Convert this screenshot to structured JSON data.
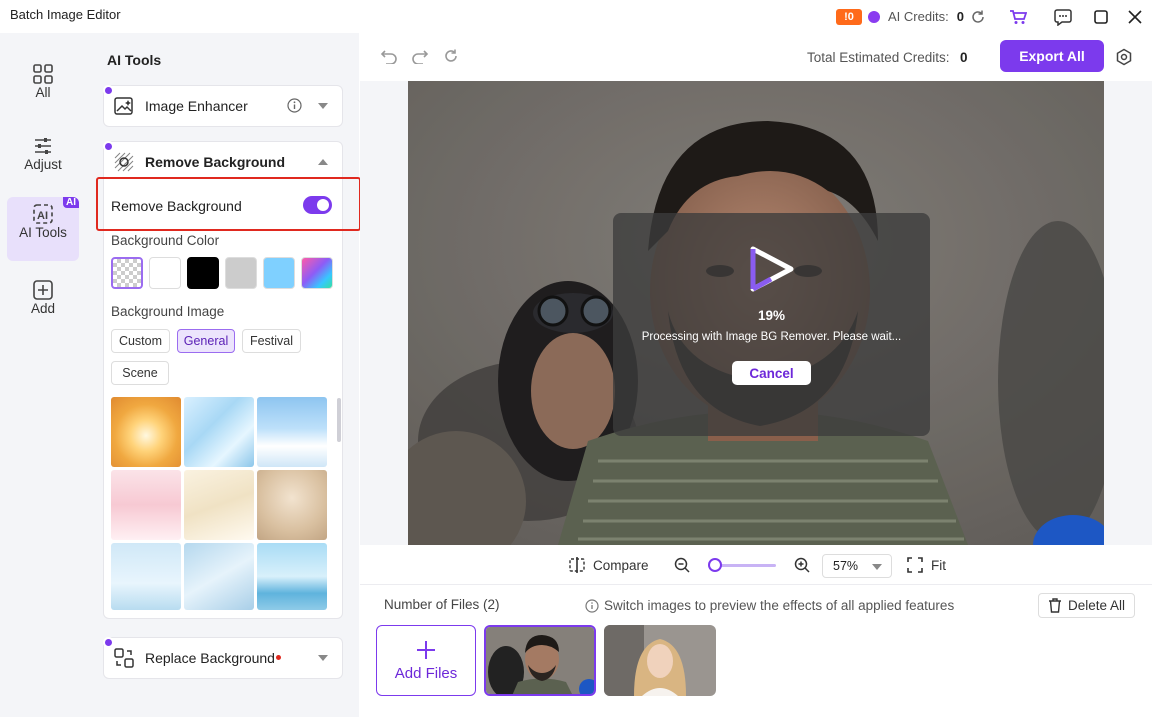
{
  "app": {
    "title": "Batch Image Editor"
  },
  "titlebar": {
    "credit_badge": "!0",
    "credits_label": "AI Credits:",
    "credits_value": "0",
    "icons": [
      "refresh-icon",
      "cart-icon",
      "chat-icon",
      "maximize-icon",
      "close-icon"
    ]
  },
  "rail": {
    "items": [
      {
        "label": "All",
        "icon": "grid-icon"
      },
      {
        "label": "Adjust",
        "icon": "sliders-icon"
      },
      {
        "label": "AI Tools",
        "icon": "ai-icon",
        "badge": "AI",
        "active": true
      },
      {
        "label": "Add",
        "icon": "plus-square-icon"
      }
    ]
  },
  "panel": {
    "title": "AI Tools",
    "tools": [
      {
        "label": "Image Enhancer",
        "expanded": false
      },
      {
        "label": "Remove Background",
        "expanded": true
      },
      {
        "label": "Replace Background",
        "expanded": false
      }
    ],
    "remove_bg": {
      "toggle_label": "Remove Background",
      "toggle_on": true,
      "bg_color_label": "Background Color",
      "colors": [
        "transparent",
        "#ffffff",
        "#000000",
        "#cccccc",
        "#7fd0ff",
        "gradient"
      ],
      "bg_image_label": "Background Image",
      "categories": [
        "Custom",
        "General",
        "Festival",
        "Scene"
      ],
      "selected_category": "General"
    }
  },
  "toolbar": {
    "total_label": "Total Estimated Credits:",
    "total_value": "0",
    "export_label": "Export All"
  },
  "processing": {
    "percent": "19%",
    "message": "Processing with Image BG Remover. Please wait...",
    "cancel_label": "Cancel"
  },
  "zoombar": {
    "compare_label": "Compare",
    "zoom_value": "57%",
    "fit_label": "Fit"
  },
  "files": {
    "count_label": "Number of Files (2)",
    "hint": "Switch images to preview the effects of all applied features",
    "delete_label": "Delete All",
    "add_label": "Add Files"
  },
  "colors": {
    "accent": "#7c3aed",
    "highlight": "#e0291f"
  }
}
